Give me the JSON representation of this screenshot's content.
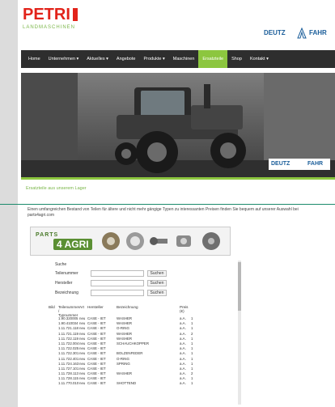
{
  "header": {
    "logo_text": "PETRI",
    "logo_subtitle": "LANDMASCHINEN",
    "brand_left": "DEUTZ",
    "brand_right": "FAHR"
  },
  "nav": {
    "items": [
      {
        "label": "Home"
      },
      {
        "label": "Unternehmen ▾"
      },
      {
        "label": "Aktuelles ▾"
      },
      {
        "label": "Angebote"
      },
      {
        "label": "Produkte ▾"
      },
      {
        "label": "Maschinen"
      },
      {
        "label": "Ersatzteile"
      },
      {
        "label": "Shop"
      },
      {
        "label": "Kontakt ▾"
      }
    ],
    "active_index": 6
  },
  "hero": {
    "brand_left": "DEUTZ",
    "brand_right": "FAHR"
  },
  "content": {
    "section_title": "Ersatzteile aus unserem Lager",
    "intro": "Einen umfangreichen Bestand von Teilen für ältere und nicht mehr gängige Typen zu interessanten Preisen finden Sie bequem auf unserer Auswahl bei parts4agri.com",
    "banner_word1": "PARTS",
    "banner_word2": "4 AGRI"
  },
  "search": {
    "heading": "Suche",
    "fields": [
      {
        "label": "Teilenummer",
        "value": "",
        "button": "Suchen"
      },
      {
        "label": "Hersteller",
        "value": "",
        "button": "Suchen"
      },
      {
        "label": "Bezeichnung",
        "value": "",
        "button": "Suchen"
      }
    ]
  },
  "results": {
    "columns": [
      "Bild",
      "Teilenummer / Typnummer",
      "Art",
      "Hersteller",
      "Bezeichnung",
      "Preis (€)",
      ""
    ],
    "rows": [
      [
        "",
        "1.90.320005",
        "neu",
        "CASE - IET",
        "WASHER",
        "a.A.",
        "1"
      ],
      [
        "",
        "1.90.410034",
        "neu",
        "CASE - IET",
        "WASHER",
        "a.A.",
        "1"
      ],
      [
        "",
        "1.11.721.118",
        "neu",
        "CASE - IET",
        "O-RING",
        "a.A.",
        "1"
      ],
      [
        "",
        "1.11.721.119",
        "neu",
        "CASE - IET",
        "WASHER",
        "a.A.",
        "2"
      ],
      [
        "",
        "1.11.722.119",
        "neu",
        "CASE - IET",
        "WASHER",
        "a.A.",
        "1"
      ],
      [
        "",
        "1.11.722.004",
        "neu",
        "CASE - IET",
        "SCHAUCHKOPPER",
        "a.A.",
        "1"
      ],
      [
        "",
        "1.11.722.025",
        "neu",
        "CASE - IET",
        "",
        "a.A.",
        "1"
      ],
      [
        "",
        "1.11.722.301",
        "neu",
        "CASE - IET",
        "BOLZENFEDER",
        "a.A.",
        "1"
      ],
      [
        "",
        "1.11.722.401",
        "neu",
        "CASE - IET",
        "O-RING",
        "a.A.",
        "1"
      ],
      [
        "",
        "1.11.724.163",
        "neu",
        "CASE - IET",
        "SPRING",
        "a.A.",
        "1"
      ],
      [
        "",
        "1.11.727.101",
        "neu",
        "CASE - IET",
        "",
        "a.A.",
        "1"
      ],
      [
        "",
        "1.11.728.113",
        "neu",
        "CASE - IET",
        "WASHER",
        "a.A.",
        "2"
      ],
      [
        "",
        "1.11.728.115",
        "neu",
        "CASE - IET",
        "",
        "a.A.",
        "1"
      ],
      [
        "",
        "1.11.770.010",
        "neu",
        "CASE - IET",
        "SHOTTEND",
        "a.A.",
        "1"
      ]
    ]
  }
}
